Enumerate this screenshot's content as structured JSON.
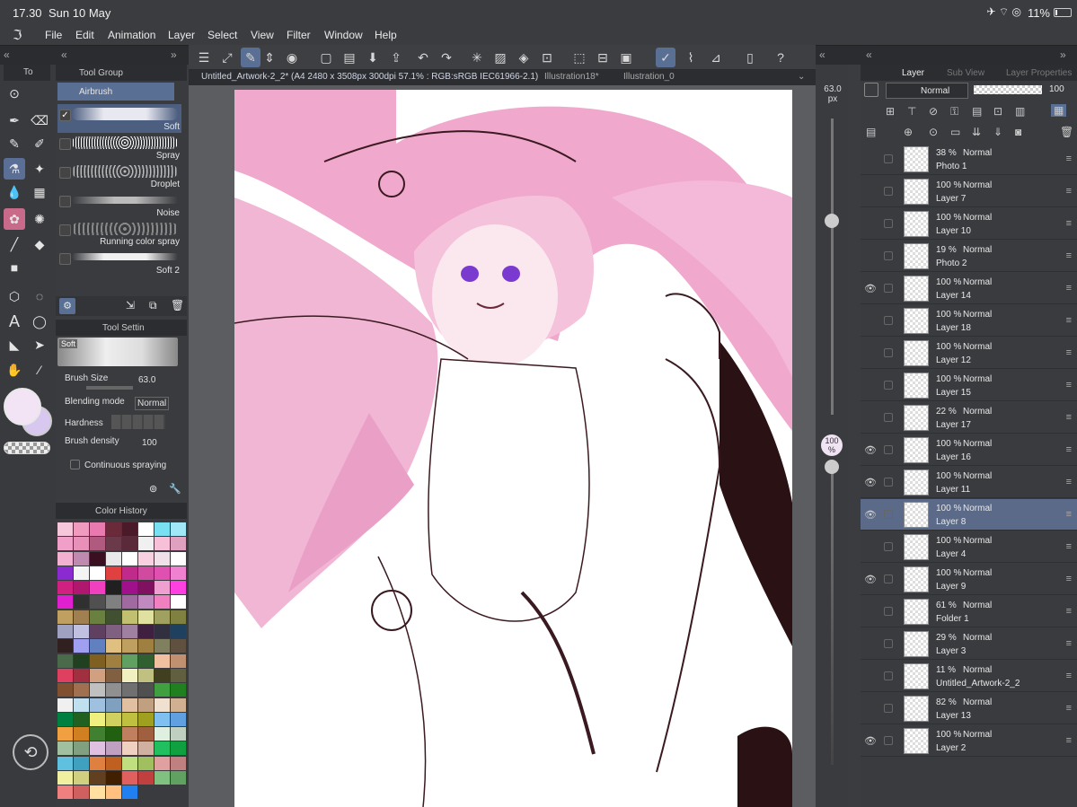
{
  "status": {
    "time": "17.30",
    "date": "Sun 10 May",
    "battery": "11%"
  },
  "menu": [
    "File",
    "Edit",
    "Animation",
    "Layer",
    "Select",
    "View",
    "Filter",
    "Window",
    "Help"
  ],
  "panels": {
    "tool_tab": "To",
    "tool_group": "Tool Group",
    "tool_setting": "Tool Settin",
    "color_history": "Color History",
    "layer_tab": "Layer",
    "sub_view_tab": "Sub View",
    "layer_props_tab": "Layer Properties"
  },
  "subtools": {
    "active_group": "Airbrush",
    "items": [
      {
        "label": "Soft",
        "checked": true
      },
      {
        "label": "Spray"
      },
      {
        "label": "Droplet"
      },
      {
        "label": "Noise"
      },
      {
        "label": "Running color spray"
      },
      {
        "label": "Soft 2"
      }
    ]
  },
  "tool_settings": {
    "preview_label": "Soft",
    "brush_size_label": "Brush Size",
    "brush_size_value": "63.0",
    "blend_label": "Blending mode",
    "blend_value": "Normal",
    "hardness_label": "Hardness",
    "density_label": "Brush density",
    "density_value": "100",
    "continuous_label": "Continuous spraying"
  },
  "document": {
    "tabs": [
      "Untitled_Artwork-2_2* (A4 2480 x 3508px 300dpi 57.1% : RGB:sRGB IEC61966-2.1)",
      "Illustration18*",
      "Illustration_0"
    ]
  },
  "size_slider": {
    "value": "63.0",
    "unit": "px",
    "opacity": "100",
    "opacity_unit": "%"
  },
  "layer_panel": {
    "blend_mode": "Normal",
    "opacity": "100"
  },
  "layers": [
    {
      "pct": "38 %",
      "mode": "Normal",
      "name": "Photo 1",
      "visible": false
    },
    {
      "pct": "100 %",
      "mode": "Normal",
      "name": "Layer 7",
      "visible": false
    },
    {
      "pct": "100 %",
      "mode": "Normal",
      "name": "Layer 10",
      "visible": false
    },
    {
      "pct": "19 %",
      "mode": "Normal",
      "name": "Photo 2",
      "visible": false
    },
    {
      "pct": "100 %",
      "mode": "Normal",
      "name": "Layer 14",
      "visible": true
    },
    {
      "pct": "100 %",
      "mode": "Normal",
      "name": "Layer 18",
      "visible": false
    },
    {
      "pct": "100 %",
      "mode": "Normal",
      "name": "Layer 12",
      "visible": false
    },
    {
      "pct": "100 %",
      "mode": "Normal",
      "name": "Layer 15",
      "visible": false
    },
    {
      "pct": "22 %",
      "mode": "Normal",
      "name": "Layer 17",
      "visible": false
    },
    {
      "pct": "100 %",
      "mode": "Normal",
      "name": "Layer 16",
      "visible": true
    },
    {
      "pct": "100 %",
      "mode": "Normal",
      "name": "Layer 11",
      "visible": true
    },
    {
      "pct": "100 %",
      "mode": "Normal",
      "name": "Layer 8",
      "visible": true,
      "selected": true
    },
    {
      "pct": "100 %",
      "mode": "Normal",
      "name": "Layer 4",
      "visible": false
    },
    {
      "pct": "100 %",
      "mode": "Normal",
      "name": "Layer 9",
      "visible": true
    },
    {
      "pct": "61 %",
      "mode": "Normal",
      "name": "Folder 1",
      "visible": false
    },
    {
      "pct": "29 %",
      "mode": "Normal",
      "name": "Layer 3",
      "visible": false
    },
    {
      "pct": "11 %",
      "mode": "Normal",
      "name": "Untitled_Artwork-2_2",
      "visible": false
    },
    {
      "pct": "82 %",
      "mode": "Normal",
      "name": "Layer 13",
      "visible": false
    },
    {
      "pct": "100 %",
      "mode": "Normal",
      "name": "Layer 2",
      "visible": true
    }
  ],
  "swatch_colors": [
    "#f6c6da",
    "#f09ac0",
    "#e87ab0",
    "#6a2a3a",
    "#4a1a2a",
    "#ffffff",
    "#78e0f0",
    "#a0e8f8",
    "#f0a0c8",
    "#e890b8",
    "#b05a80",
    "#6a3a4a",
    "#5a2a3a",
    "#f0f0f0",
    "#f8c0d8",
    "#e0a0c0",
    "#f4b0d0",
    "#c08ab0",
    "#3a1020",
    "#e8e8e8",
    "#ffffff",
    "#f8d0e0",
    "#f0e0e8",
    "#ffffff",
    "#8a2ad0",
    "#f4f4f4",
    "#ffffff",
    "#e04040",
    "#c02a8a",
    "#d04aa0",
    "#e050b0",
    "#f080d0",
    "#d02080",
    "#b01870",
    "#f040c0",
    "#202020",
    "#a0108a",
    "#801060",
    "#f0a0d0",
    "#ff40e0",
    "#e020d0",
    "#303030",
    "#505050",
    "#808080",
    "#a06aa0",
    "#c08ac0",
    "#f080c0",
    "#ffffff",
    "#c0a060",
    "#a08050",
    "#6a8040",
    "#405030",
    "#c0c070",
    "#e0e0a0",
    "#a0a060",
    "#808040",
    "#a0a0c0",
    "#c0c0e0",
    "#604060",
    "#806080",
    "#a080a0",
    "#402040",
    "#303040",
    "#204060",
    "#302020",
    "#a0a0f0",
    "#6080c0",
    "#e0c080",
    "#c0a060",
    "#a08040",
    "#808060",
    "#605040",
    "#4a6a4a",
    "#204020",
    "#806020",
    "#a08040",
    "#60a060",
    "#306030",
    "#f0c0a0",
    "#c09070",
    "#e04060",
    "#a03040",
    "#d0a080",
    "#806040",
    "#f0f0c0",
    "#c0c080",
    "#404020",
    "#606040",
    "#805030",
    "#a07050",
    "#c0c0c0",
    "#909090",
    "#707070",
    "#505050",
    "#40a040",
    "#208020",
    "#f0f0f0",
    "#c0e0f0",
    "#a0c0e0",
    "#80a0c0",
    "#e0c0a0",
    "#c0a080",
    "#f0e0d0",
    "#d0b090",
    "#008040",
    "#206020",
    "#f0f080",
    "#d0d060",
    "#c0c040",
    "#a0a020",
    "#80c0f0",
    "#60a0e0",
    "#f0a040",
    "#d08020",
    "#408030",
    "#206010",
    "#c08060",
    "#a06040",
    "#e0f0e0",
    "#c0d0c0",
    "#a0c0a0",
    "#80a080",
    "#e0c0e0",
    "#c0a0c0",
    "#f0d0c0",
    "#d0b0a0",
    "#20c060",
    "#10a040",
    "#60c0e0",
    "#40a0c0",
    "#e08040",
    "#c06020",
    "#c0e080",
    "#a0c060",
    "#e0a0a0",
    "#c08080",
    "#f0f0a0",
    "#d0d080",
    "#604020",
    "#402000",
    "#e06060",
    "#c04040",
    "#80c080",
    "#60a060",
    "#f08080",
    "#d06060",
    "#ffe0a0",
    "#ffc080",
    "#2080f0"
  ]
}
